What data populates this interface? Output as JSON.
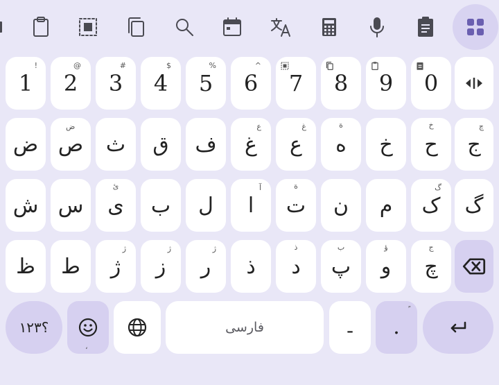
{
  "toolbar": {
    "icons": [
      "clipboard-icon",
      "select-all-icon",
      "copy-icon",
      "search-icon",
      "calendar-icon",
      "translate-icon",
      "calculator-icon",
      "microphone-icon",
      "clipboard-text-icon",
      "apps-grid-icon"
    ]
  },
  "keyboard": {
    "language_label": "فارسی",
    "row1": [
      {
        "main": "1",
        "hint": "!"
      },
      {
        "main": "2",
        "hint": "@"
      },
      {
        "main": "3",
        "hint": "#"
      },
      {
        "main": "4",
        "hint": "$"
      },
      {
        "main": "5",
        "hint": "%"
      },
      {
        "main": "6",
        "hint": "^"
      },
      {
        "main": "7",
        "hint_icon": "select-all-icon"
      },
      {
        "main": "8",
        "hint_icon": "copy-icon"
      },
      {
        "main": "9",
        "hint_icon": "clipboard-icon"
      },
      {
        "main": "0",
        "hint_icon": "clipboard-text-icon"
      }
    ],
    "row2": [
      {
        "main": "ض",
        "hint": ""
      },
      {
        "main": "ص",
        "hint": "ض"
      },
      {
        "main": "ث",
        "hint": ""
      },
      {
        "main": "ق",
        "hint": ""
      },
      {
        "main": "ف",
        "hint": ""
      },
      {
        "main": "غ",
        "hint": "ع"
      },
      {
        "main": "ع",
        "hint": "غ"
      },
      {
        "main": "ه",
        "hint": "ة"
      },
      {
        "main": "خ",
        "hint": ""
      },
      {
        "main": "ح",
        "hint": "خ"
      },
      {
        "main": "ج",
        "hint": "چ"
      }
    ],
    "row3": [
      {
        "main": "ش",
        "hint": ""
      },
      {
        "main": "س",
        "hint": ""
      },
      {
        "main": "ی",
        "hint": "ئ"
      },
      {
        "main": "ب",
        "hint": ""
      },
      {
        "main": "ل",
        "hint": ""
      },
      {
        "main": "ا",
        "hint": "آ"
      },
      {
        "main": "ت",
        "hint": "ة"
      },
      {
        "main": "ن",
        "hint": ""
      },
      {
        "main": "م",
        "hint": ""
      },
      {
        "main": "ک",
        "hint": "گ"
      },
      {
        "main": "گ",
        "hint": ""
      }
    ],
    "row4": [
      {
        "main": "ظ",
        "hint": ""
      },
      {
        "main": "ط",
        "hint": ""
      },
      {
        "main": "ژ",
        "hint": "ژ"
      },
      {
        "main": "ز",
        "hint": "ژ"
      },
      {
        "main": "ر",
        "hint": "ژ"
      },
      {
        "main": "ذ",
        "hint": ""
      },
      {
        "main": "د",
        "hint": "ذ"
      },
      {
        "main": "پ",
        "hint": "ب"
      },
      {
        "main": "و",
        "hint": "ؤ"
      },
      {
        "main": "چ",
        "hint": "ج"
      }
    ],
    "row5": {
      "symbols_label": "؟۱۲۳",
      "emoji_hint": "،",
      "dash_label": "-",
      "period_label": ".",
      "period_hint": "ً"
    },
    "colors": {
      "background": "#e9e7f7",
      "key": "#ffffff",
      "function_key": "#d6d0f0",
      "text": "#222222"
    }
  }
}
